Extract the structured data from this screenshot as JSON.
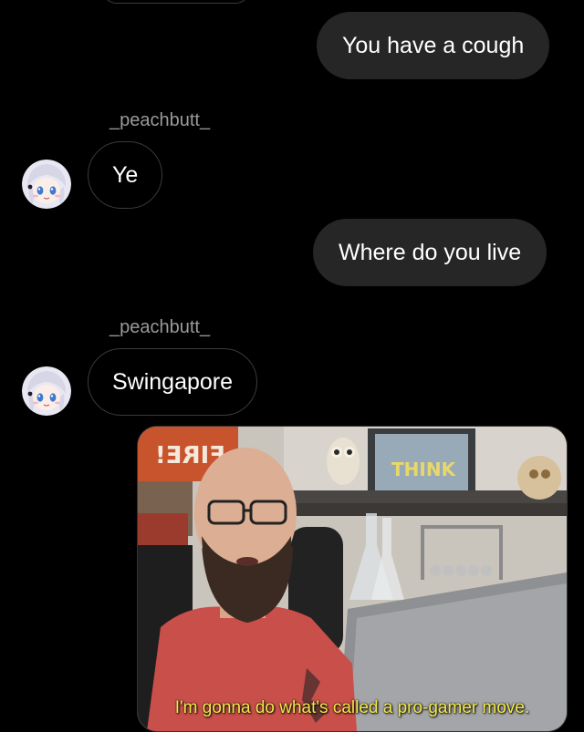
{
  "messages": [
    {
      "direction": "outgoing",
      "text": "You have a cough"
    },
    {
      "direction": "incoming",
      "sender": "_peachbutt_",
      "text": "Ye"
    },
    {
      "direction": "outgoing",
      "text": "Where do you live"
    },
    {
      "direction": "incoming",
      "sender": "_peachbutt_",
      "text": "Swingapore"
    }
  ],
  "media": {
    "type": "video-still",
    "caption": "I'm gonna do what's called a pro-gamer move.",
    "poster_text": "FIRE!",
    "frame_text": "THINK"
  },
  "colors": {
    "background": "#000000",
    "outgoing_bubble": "#262626",
    "incoming_border": "#3c3c3c",
    "sender_name": "#9a9a9a",
    "caption": "#f2e84a"
  }
}
